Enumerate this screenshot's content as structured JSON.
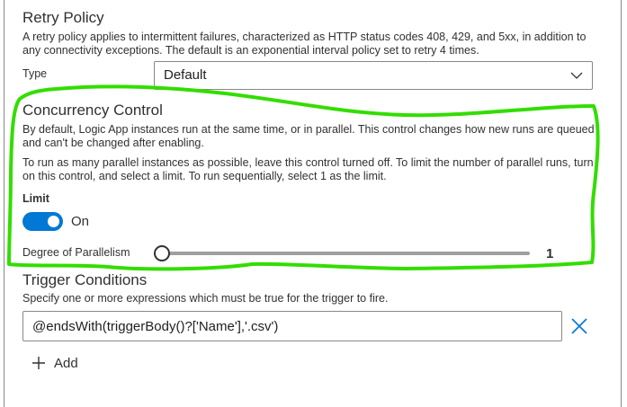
{
  "retry_policy": {
    "title": "Retry Policy",
    "description": "A retry policy applies to intermittent failures, characterized as HTTP status codes 408, 429, and 5xx, in addition to any connectivity exceptions. The default is an exponential interval policy set to retry 4 times.",
    "type_label": "Type",
    "type_value": "Default",
    "dropdown_icon": "chevron-down-icon"
  },
  "concurrency": {
    "title": "Concurrency Control",
    "description_1": "By default, Logic App instances run at the same time, or in parallel. This control changes how new runs are queued and can't be changed after enabling.",
    "description_2": "To run as many parallel instances as possible, leave this control turned off. To limit the number of parallel runs, turn on this control, and select a limit. To run sequentially, select 1 as the limit.",
    "limit_label": "Limit",
    "toggle_state": "On",
    "toggle_on": true,
    "parallelism_label": "Degree of Parallelism",
    "parallelism_value": "1",
    "accent_color": "#0078d4",
    "highlight_color": "#33dd00"
  },
  "trigger_conditions": {
    "title": "Trigger Conditions",
    "description": "Specify one or more expressions which must be true for the trigger to fire.",
    "expression": "@endsWith(triggerBody()?['Name'],'.csv')",
    "clear_icon": "close-icon",
    "add_icon": "plus-icon",
    "add_label": "Add"
  }
}
